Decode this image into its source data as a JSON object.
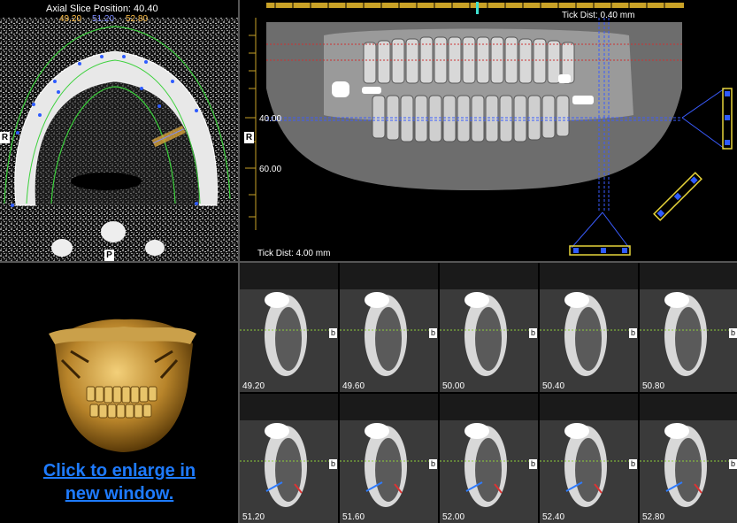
{
  "axial": {
    "title": "Axial Slice Position: 40.40",
    "pos_left": "49.20",
    "pos_mid": "51.20",
    "pos_right": "52.80",
    "orient_left": "R",
    "orient_bottom": "P",
    "colors": {
      "left": "#ffc04a",
      "mid": "#7e8cff",
      "right": "#ffc04a"
    }
  },
  "panoramic": {
    "tick_top": "Tick Dist: 0.40 mm",
    "tick_bottom": "Tick Dist: 4.00 mm",
    "ruler_40": "40.00",
    "ruler_60": "60.00",
    "orient_left": "R"
  },
  "render3d": {
    "enlarge_line1": "Click to enlarge in",
    "enlarge_line2": "new window."
  },
  "cross_sections": {
    "side_label": "b",
    "row1": [
      "49.20",
      "49.60",
      "50.00",
      "50.40",
      "50.80"
    ],
    "row2": [
      "51.20",
      "51.60",
      "52.00",
      "52.40",
      "52.80"
    ],
    "selected": "51.20"
  }
}
